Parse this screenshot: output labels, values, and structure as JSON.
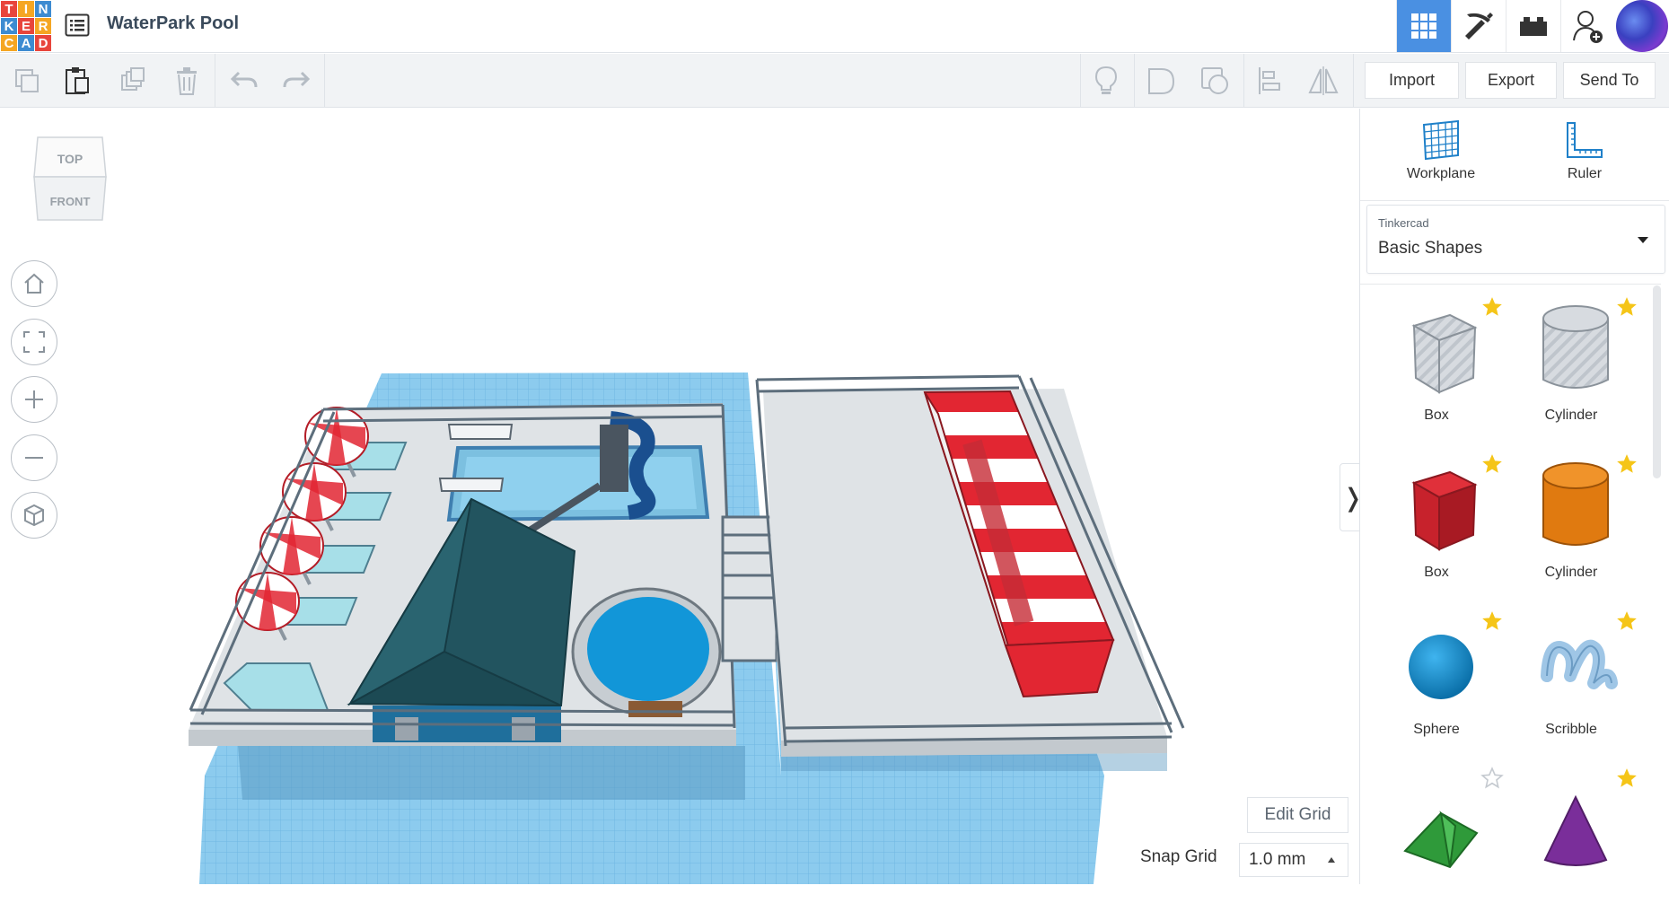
{
  "header": {
    "logo_letters": [
      "T",
      "I",
      "N",
      "K",
      "E",
      "R",
      "C",
      "A",
      "D"
    ],
    "logo_colors": [
      "#e8453c",
      "#f5a623",
      "#3d8bd1",
      "#3d8bd1",
      "#e8453c",
      "#f5a623",
      "#f5a623",
      "#3d8bd1",
      "#e8453c"
    ],
    "design_title": "WaterPark Pool",
    "accent_color": "#4a90e2"
  },
  "toolbar": {
    "import_label": "Import",
    "export_label": "Export",
    "send_to_label": "Send To"
  },
  "panel": {
    "workplane_label": "Workplane",
    "ruler_label": "Ruler",
    "library": {
      "category": "Tinkercad",
      "value": "Basic Shapes"
    },
    "shapes": [
      {
        "name": "Box",
        "icon": "box-hole-icon",
        "starred": true
      },
      {
        "name": "Cylinder",
        "icon": "cylinder-hole-icon",
        "starred": true
      },
      {
        "name": "Box",
        "icon": "box-icon",
        "starred": true
      },
      {
        "name": "Cylinder",
        "icon": "cylinder-icon",
        "starred": true
      },
      {
        "name": "Sphere",
        "icon": "sphere-icon",
        "starred": true
      },
      {
        "name": "Scribble",
        "icon": "scribble-icon",
        "starred": true
      },
      {
        "name": "",
        "icon": "roof-icon",
        "starred": false
      },
      {
        "name": "",
        "icon": "cone-icon",
        "starred": true
      }
    ]
  },
  "viewport": {
    "viewcube_top": "TOP",
    "viewcube_front": "FRONT",
    "edit_grid_label": "Edit Grid",
    "snap_grid_label": "Snap Grid",
    "snap_grid_value": "1.0 mm"
  }
}
